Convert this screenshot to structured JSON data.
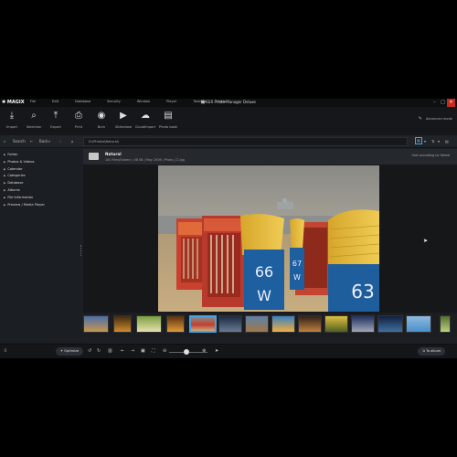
{
  "app": {
    "logo": "✱ MAGIX",
    "title": "MAGIX Photo Manager Deluxe",
    "menu": [
      "File",
      "Edit",
      "Database",
      "Security",
      "Window",
      "Player",
      "Tasks",
      "Help"
    ]
  },
  "toolbar": {
    "tools": [
      {
        "label": "Import",
        "icon": "⤓",
        "name": "import"
      },
      {
        "label": "Selection",
        "icon": "⌕",
        "name": "selection"
      },
      {
        "label": "Export",
        "icon": "⤒",
        "name": "export"
      },
      {
        "label": "Print",
        "icon": "⎙",
        "name": "print"
      },
      {
        "label": "Burn",
        "icon": "◉",
        "name": "burn"
      },
      {
        "label": "Slideshow",
        "icon": "▶",
        "name": "slideshow"
      },
      {
        "label": "CloudImport",
        "icon": "☁",
        "name": "cloudimport"
      },
      {
        "label": "Photo book",
        "icon": "▤",
        "name": "photo-book"
      }
    ],
    "advanced_mode": "Advanced mode"
  },
  "nav": {
    "search": "Search",
    "back": "Back",
    "path": "D:\\Photos\\Natural\\"
  },
  "sidebar": {
    "items": [
      "Folder",
      "Photos & Videos",
      "Calendar",
      "Categories",
      "Database",
      "Albums",
      "File Information",
      "Preview / Media Player"
    ]
  },
  "folder": {
    "name": "Natural",
    "info": "100 Files/Folders  |  48 KB  |  May 2006  |  Photo_12.jpg",
    "sort": "Sort according to: Name"
  },
  "photo": {
    "chair1_number": "66",
    "chair1_letter": "W",
    "chair2_number": "67",
    "chair2_letter": "W",
    "chair3_number": "63"
  },
  "bottombar": {
    "optimize": "Optimize",
    "to_album": "To album"
  },
  "colors": {
    "accent": "#4aa3e0",
    "close_button": "#c42b1c"
  }
}
